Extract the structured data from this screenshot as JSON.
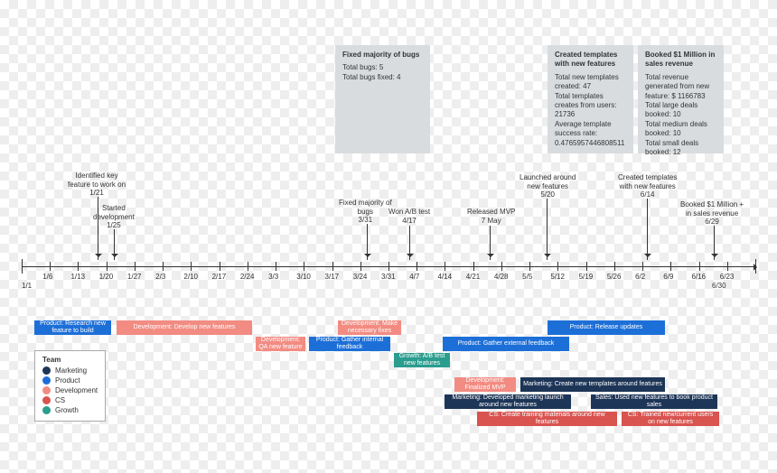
{
  "cards": {
    "bugs": {
      "title": "Fixed majority of bugs",
      "l1": "Total bugs: 5",
      "l2": "Total bugs fixed: 4"
    },
    "templates": {
      "title": "Created templates with new features",
      "l1": "Total new templates created: 47",
      "l2": "Total templates creates from users: 21736",
      "l3": "Average template success rate: 0.4765957446808511"
    },
    "revenue": {
      "title": "Booked $1 Million in sales revenue",
      "l1": "Total revenue generated from new feature: $ 1166783",
      "l2": "Total large deals booked: 10",
      "l3": "Total medium deals booked: 10",
      "l4": "Total small deals booked: 12"
    }
  },
  "annotations": {
    "a1": {
      "l1": "Identified key",
      "l2": "feature to work on",
      "l3": "1/21"
    },
    "a2": {
      "l1": "Started",
      "l2": "development",
      "l3": "1/25"
    },
    "a3": {
      "l1": "Fixed majority of",
      "l2": "bugs",
      "l3": "3/31"
    },
    "a4": {
      "l1": "Won A/B test",
      "l2": "4/17"
    },
    "a5": {
      "l1": "Released MVP",
      "l2": "7 May"
    },
    "a6": {
      "l1": "Launched around",
      "l2": "new features",
      "l3": "5/20"
    },
    "a7": {
      "l1": "Created templates",
      "l2": "with new features",
      "l3": "6/14"
    },
    "a8": {
      "l1": "Booked $1 Million +",
      "l2": "in sales revenue",
      "l3": "6/29"
    }
  },
  "ticks": {
    "t0": "1/1",
    "t1": "1/6",
    "t2": "1/13",
    "t3": "1/20",
    "t4": "1/27",
    "t5": "2/3",
    "t6": "2/10",
    "t7": "2/17",
    "t8": "2/24",
    "t9": "3/3",
    "t10": "3/10",
    "t11": "3/17",
    "t12": "3/24",
    "t13": "3/31",
    "t14": "4/7",
    "t15": "4/14",
    "t16": "4/21",
    "t17": "4/28",
    "t18": "5/5",
    "t19": "5/12",
    "t20": "5/19",
    "t21": "5/26",
    "t22": "6/2",
    "t23": "6/9",
    "t24": "6/16",
    "t25": "6/23",
    "t26": "6/30"
  },
  "bars": {
    "b1": "Product: Research new feature to build",
    "b2": "Development: Develop new features",
    "b3": "Development: QA new feature",
    "b4": "Development: Make necessary fixes",
    "b5": "Product: Gather internal feedback",
    "b6": "Growth: A/B test new features",
    "b7": "Product: Gather external feedback",
    "b8": "Development: Finalized MVP",
    "b9": "Marketing: Developed marketing launch around new features",
    "b10": "Product: Release updates",
    "b11": "Marketing: Create new templates around features",
    "b12": "CS: Create training materials around new features",
    "b13": "Sales: Used new features to book product sales",
    "b14": "CS: Trained new/current users on new features"
  },
  "legend": {
    "title": "Team",
    "i1": "Marketing",
    "i2": "Product",
    "i3": "Development",
    "i4": "CS",
    "i5": "Growth"
  }
}
